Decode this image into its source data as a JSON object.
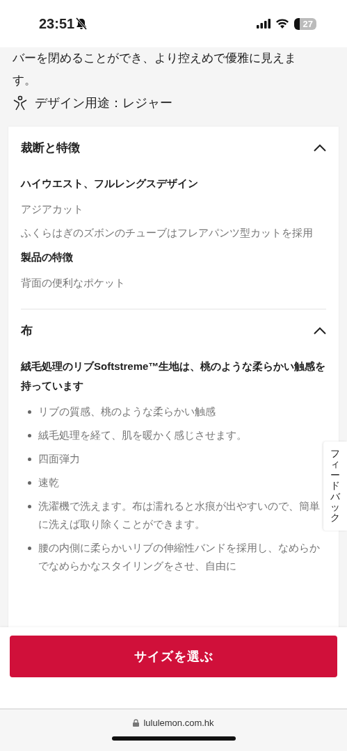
{
  "status_bar": {
    "time": "23:51",
    "silent": true,
    "battery": "27"
  },
  "intro": {
    "text": "バーを閉めることができ、より控えめで優雅に見えます。",
    "use": "デザイン用途：レジャー"
  },
  "sections": [
    {
      "title": "裁断と特徴",
      "expanded": true,
      "blocks": [
        {
          "kind": "heading",
          "text": "ハイウエスト、フルレングスデザイン"
        },
        {
          "kind": "para",
          "text": "アジアカット"
        },
        {
          "kind": "para",
          "text": "ふくらはぎのズボンのチューブはフレアパンツ型カットを採用"
        },
        {
          "kind": "heading",
          "text": "製品の特徴"
        },
        {
          "kind": "para",
          "text": "背面の便利なポケット"
        }
      ]
    },
    {
      "title": "布",
      "expanded": true,
      "blocks": [
        {
          "kind": "heading",
          "text": "絨毛処理のリブSoftstreme™生地は、桃のような柔らかい触感を持っています"
        },
        {
          "kind": "bullet",
          "text": "リブの質感、桃のような柔らかい触感"
        },
        {
          "kind": "bullet",
          "text": "絨毛処理を経て、肌を暖かく感じさせます。"
        },
        {
          "kind": "bullet",
          "text": "四面弾力"
        },
        {
          "kind": "bullet",
          "text": "速乾"
        },
        {
          "kind": "bullet",
          "text": "洗濯機で洗えます。布は濡れると水痕が出やすいので、簡単に洗えば取り除くことができます。"
        },
        {
          "kind": "bullet",
          "text": "腰の内側に柔らかいリブの伸縮性バンドを採用し、なめらかでなめらかなスタイリングをさせ、自由に"
        }
      ]
    }
  ],
  "feedback_tab": "フィードバック",
  "cta_button": "サイズを選ぶ",
  "address_bar": {
    "url": "lululemon.com.hk"
  }
}
